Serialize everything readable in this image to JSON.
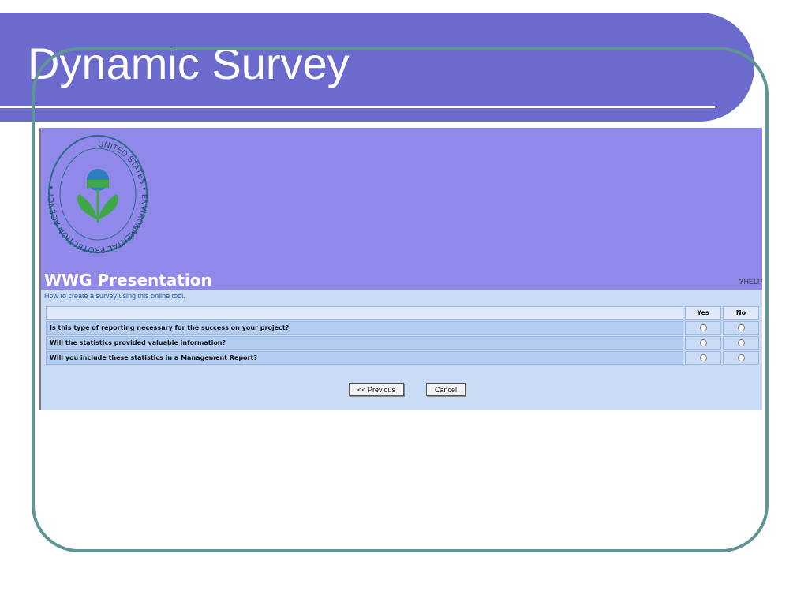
{
  "slide": {
    "title": "Dynamic Survey",
    "colors": {
      "title_band": "#6a6bcc",
      "frame": "#5f9595"
    }
  },
  "screenshot": {
    "logo": {
      "name": "epa-seal-icon",
      "text": "UNITED STATES ENVIRONMENTAL PROTECTION AGENCY"
    },
    "title": "WWG Presentation",
    "help_label": "HELP",
    "subtitle": "How to create a survey using this online tool.",
    "table": {
      "headers": [
        "",
        "Yes",
        "No"
      ],
      "rows": [
        {
          "question": "Is this type of reporting necessary for the success on your project?"
        },
        {
          "question": "Will the statistics provided valuable information?"
        },
        {
          "question": "Will you include these statistics in a Management Report?"
        }
      ]
    },
    "buttons": {
      "previous": "<< Previous",
      "cancel": "Cancel"
    },
    "colors": {
      "header": "#9089ea",
      "body": "#c9dbf5"
    }
  }
}
